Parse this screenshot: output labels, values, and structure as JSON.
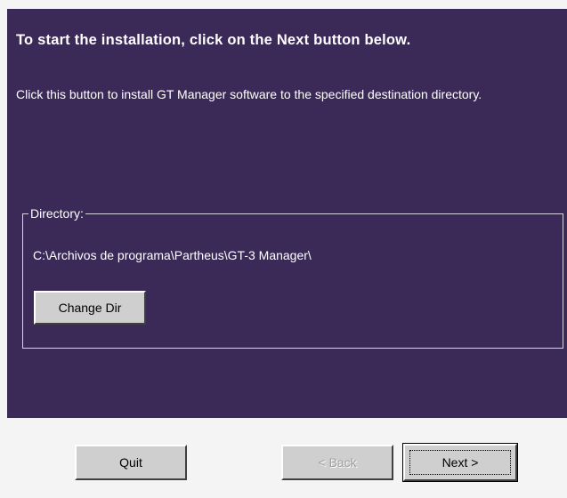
{
  "installer": {
    "heading": "To start the installation, click on the Next button below.",
    "description": "Click this button to install GT Manager software to the specified destination directory.",
    "directory_group_label": "Directory:",
    "directory_path": "C:\\Archivos de programa\\Partheus\\GT-3 Manager\\",
    "change_dir_label": "Change Dir"
  },
  "footer": {
    "quit_label": "Quit",
    "back_label": "< Back",
    "next_label": "Next >"
  },
  "colors": {
    "panel_background": "#3b2a57",
    "dialog_background": "#f4f4f4",
    "button_face": "#cfcfcf",
    "disabled_text": "#a0a0a0"
  }
}
